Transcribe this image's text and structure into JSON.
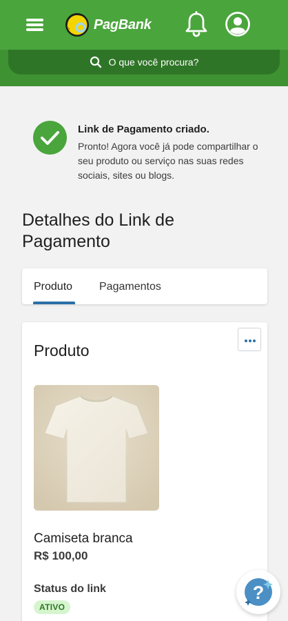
{
  "header": {
    "brand_name": "PagBank",
    "menu_icon": "hamburger-menu-icon",
    "notification_icon": "bell-icon",
    "profile_icon": "user-avatar-icon",
    "brand_color": "#4aa53c"
  },
  "search": {
    "placeholder": "O que você procura?",
    "icon": "search-icon"
  },
  "notice": {
    "icon": "check-circle-icon",
    "title": "Link de Pagamento criado.",
    "body": "Pronto! Agora você já pode compartilhar o seu produto ou serviço nas suas redes sociais, sites ou blogs."
  },
  "page": {
    "title": "Detalhes do Link de Pagamento"
  },
  "tabs": [
    {
      "label": "Produto",
      "active": true
    },
    {
      "label": "Pagamentos",
      "active": false
    }
  ],
  "product_card": {
    "title": "Produto",
    "more_icon": "more-options-icon",
    "image": "white-tshirt",
    "name": "Camiseta branca",
    "price": "R$ 100,00",
    "status_label": "Status do link",
    "status_value": "ATIVO"
  },
  "help": {
    "icon": "help-question-icon"
  }
}
